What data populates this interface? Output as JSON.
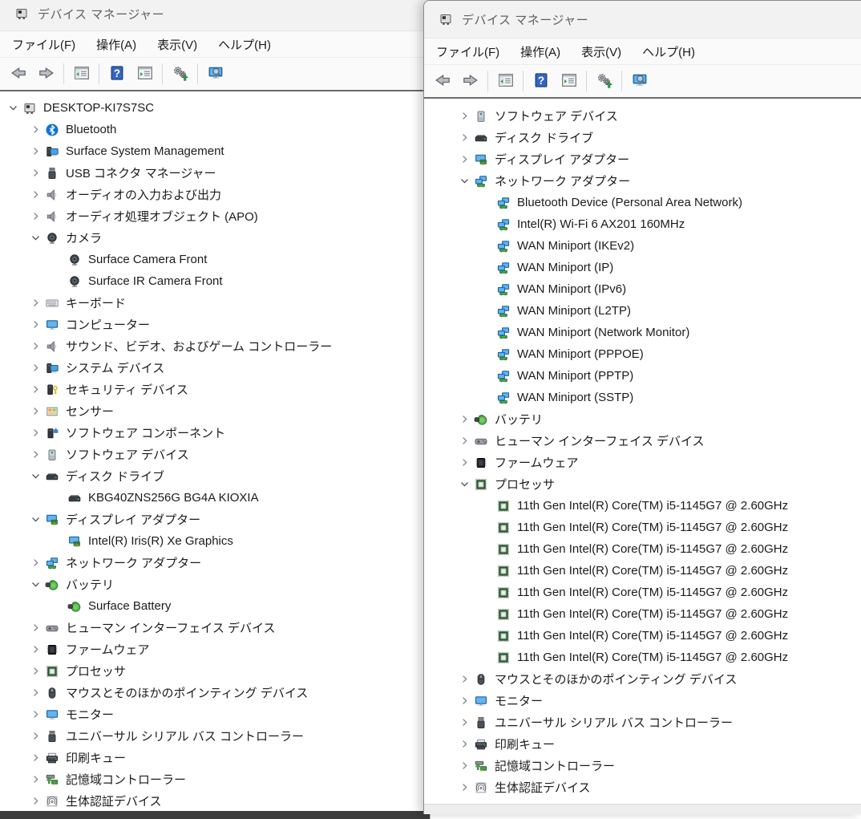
{
  "colors": {
    "accent_blue": "#4aa3e8",
    "status_green": "#46b749",
    "bluetooth_blue": "#1272d6",
    "processor_green": "#2f6136",
    "key_yellow": "#e2b72e",
    "inactive_title_text": "#5f5f5f",
    "tree_text": "#1b1b1b"
  },
  "toolbar_icons": [
    "back",
    "forward",
    "|",
    "show-console-tree",
    "|",
    "help",
    "show-properties",
    "|",
    "scan-hardware",
    "|",
    "search-computer"
  ],
  "windows": {
    "left": {
      "title": "デバイス マネージャー",
      "menu": [
        {
          "name": "file",
          "label": "ファイル(F)"
        },
        {
          "name": "action",
          "label": "操作(A)"
        },
        {
          "name": "view",
          "label": "表示(V)"
        },
        {
          "name": "help",
          "label": "ヘルプ(H)"
        }
      ],
      "tree": [
        {
          "label": "DESKTOP-KI7S7SC",
          "icon": "device-manager",
          "level": 0,
          "expander": "expanded"
        },
        {
          "label": "Bluetooth",
          "icon": "bluetooth",
          "level": 1,
          "expander": "collapsed"
        },
        {
          "label": "Surface System Management",
          "icon": "system",
          "level": 1,
          "expander": "collapsed"
        },
        {
          "label": "USB コネクタ マネージャー",
          "icon": "usb",
          "level": 1,
          "expander": "collapsed"
        },
        {
          "label": "オーディオの入力および出力",
          "icon": "speaker",
          "level": 1,
          "expander": "collapsed"
        },
        {
          "label": "オーディオ処理オブジェクト (APO)",
          "icon": "speaker",
          "level": 1,
          "expander": "collapsed"
        },
        {
          "label": "カメラ",
          "icon": "camera",
          "level": 1,
          "expander": "expanded"
        },
        {
          "label": "Surface Camera Front",
          "icon": "camera",
          "level": 2,
          "expander": "none"
        },
        {
          "label": "Surface IR Camera Front",
          "icon": "camera",
          "level": 2,
          "expander": "none"
        },
        {
          "label": "キーボード",
          "icon": "keyboard",
          "level": 1,
          "expander": "collapsed"
        },
        {
          "label": "コンピューター",
          "icon": "monitor",
          "level": 1,
          "expander": "collapsed"
        },
        {
          "label": "サウンド、ビデオ、およびゲーム コントローラー",
          "icon": "speaker",
          "level": 1,
          "expander": "collapsed"
        },
        {
          "label": "システム デバイス",
          "icon": "system",
          "level": 1,
          "expander": "collapsed"
        },
        {
          "label": "セキュリティ デバイス",
          "icon": "security",
          "level": 1,
          "expander": "collapsed"
        },
        {
          "label": "センサー",
          "icon": "sensor",
          "level": 1,
          "expander": "collapsed"
        },
        {
          "label": "ソフトウェア コンポーネント",
          "icon": "software-component",
          "level": 1,
          "expander": "collapsed"
        },
        {
          "label": "ソフトウェア デバイス",
          "icon": "software-device",
          "level": 1,
          "expander": "collapsed"
        },
        {
          "label": "ディスク ドライブ",
          "icon": "disk",
          "level": 1,
          "expander": "expanded"
        },
        {
          "label": "KBG40ZNS256G BG4A KIOXIA",
          "icon": "disk",
          "level": 2,
          "expander": "none"
        },
        {
          "label": "ディスプレイ アダプター",
          "icon": "display-adapter",
          "level": 1,
          "expander": "expanded"
        },
        {
          "label": "Intel(R) Iris(R) Xe Graphics",
          "icon": "display-adapter",
          "level": 2,
          "expander": "none"
        },
        {
          "label": "ネットワーク アダプター",
          "icon": "network-adapter",
          "level": 1,
          "expander": "collapsed"
        },
        {
          "label": "バッテリ",
          "icon": "battery",
          "level": 1,
          "expander": "expanded"
        },
        {
          "label": "Surface Battery",
          "icon": "battery",
          "level": 2,
          "expander": "none"
        },
        {
          "label": "ヒューマン インターフェイス デバイス",
          "icon": "hid",
          "level": 1,
          "expander": "collapsed"
        },
        {
          "label": "ファームウェア",
          "icon": "firmware",
          "level": 1,
          "expander": "collapsed"
        },
        {
          "label": "プロセッサ",
          "icon": "processor",
          "level": 1,
          "expander": "collapsed"
        },
        {
          "label": "マウスとそのほかのポインティング デバイス",
          "icon": "mouse",
          "level": 1,
          "expander": "collapsed"
        },
        {
          "label": "モニター",
          "icon": "monitor",
          "level": 1,
          "expander": "collapsed"
        },
        {
          "label": "ユニバーサル シリアル バス コントローラー",
          "icon": "usb",
          "level": 1,
          "expander": "collapsed"
        },
        {
          "label": "印刷キュー",
          "icon": "printer",
          "level": 1,
          "expander": "collapsed"
        },
        {
          "label": "記憶域コントローラー",
          "icon": "storage-controller",
          "level": 1,
          "expander": "collapsed"
        },
        {
          "label": "生体認証デバイス",
          "icon": "biometric",
          "level": 1,
          "expander": "collapsed"
        }
      ]
    },
    "right": {
      "title": "デバイス マネージャー",
      "menu": [
        {
          "name": "file",
          "label": "ファイル(F)"
        },
        {
          "name": "action",
          "label": "操作(A)"
        },
        {
          "name": "view",
          "label": "表示(V)"
        },
        {
          "name": "help",
          "label": "ヘルプ(H)"
        }
      ],
      "tree": [
        {
          "label": "ソフトウェア デバイス",
          "icon": "software-device",
          "level": 1,
          "expander": "collapsed"
        },
        {
          "label": "ディスク ドライブ",
          "icon": "disk",
          "level": 1,
          "expander": "collapsed"
        },
        {
          "label": "ディスプレイ アダプター",
          "icon": "display-adapter",
          "level": 1,
          "expander": "collapsed"
        },
        {
          "label": "ネットワーク アダプター",
          "icon": "network-adapter",
          "level": 1,
          "expander": "expanded"
        },
        {
          "label": "Bluetooth Device (Personal Area Network)",
          "icon": "network-adapter",
          "level": 2,
          "expander": "none"
        },
        {
          "label": "Intel(R) Wi-Fi 6 AX201 160MHz",
          "icon": "network-adapter",
          "level": 2,
          "expander": "none"
        },
        {
          "label": "WAN Miniport (IKEv2)",
          "icon": "network-adapter",
          "level": 2,
          "expander": "none"
        },
        {
          "label": "WAN Miniport (IP)",
          "icon": "network-adapter",
          "level": 2,
          "expander": "none"
        },
        {
          "label": "WAN Miniport (IPv6)",
          "icon": "network-adapter",
          "level": 2,
          "expander": "none"
        },
        {
          "label": "WAN Miniport (L2TP)",
          "icon": "network-adapter",
          "level": 2,
          "expander": "none"
        },
        {
          "label": "WAN Miniport (Network Monitor)",
          "icon": "network-adapter",
          "level": 2,
          "expander": "none"
        },
        {
          "label": "WAN Miniport (PPPOE)",
          "icon": "network-adapter",
          "level": 2,
          "expander": "none"
        },
        {
          "label": "WAN Miniport (PPTP)",
          "icon": "network-adapter",
          "level": 2,
          "expander": "none"
        },
        {
          "label": "WAN Miniport (SSTP)",
          "icon": "network-adapter",
          "level": 2,
          "expander": "none"
        },
        {
          "label": "バッテリ",
          "icon": "battery",
          "level": 1,
          "expander": "collapsed"
        },
        {
          "label": "ヒューマン インターフェイス デバイス",
          "icon": "hid",
          "level": 1,
          "expander": "collapsed"
        },
        {
          "label": "ファームウェア",
          "icon": "firmware",
          "level": 1,
          "expander": "collapsed"
        },
        {
          "label": "プロセッサ",
          "icon": "processor",
          "level": 1,
          "expander": "expanded"
        },
        {
          "label": "11th Gen Intel(R) Core(TM) i5-1145G7 @ 2.60GHz",
          "icon": "processor",
          "level": 2,
          "expander": "none"
        },
        {
          "label": "11th Gen Intel(R) Core(TM) i5-1145G7 @ 2.60GHz",
          "icon": "processor",
          "level": 2,
          "expander": "none"
        },
        {
          "label": "11th Gen Intel(R) Core(TM) i5-1145G7 @ 2.60GHz",
          "icon": "processor",
          "level": 2,
          "expander": "none"
        },
        {
          "label": "11th Gen Intel(R) Core(TM) i5-1145G7 @ 2.60GHz",
          "icon": "processor",
          "level": 2,
          "expander": "none"
        },
        {
          "label": "11th Gen Intel(R) Core(TM) i5-1145G7 @ 2.60GHz",
          "icon": "processor",
          "level": 2,
          "expander": "none"
        },
        {
          "label": "11th Gen Intel(R) Core(TM) i5-1145G7 @ 2.60GHz",
          "icon": "processor",
          "level": 2,
          "expander": "none"
        },
        {
          "label": "11th Gen Intel(R) Core(TM) i5-1145G7 @ 2.60GHz",
          "icon": "processor",
          "level": 2,
          "expander": "none"
        },
        {
          "label": "11th Gen Intel(R) Core(TM) i5-1145G7 @ 2.60GHz",
          "icon": "processor",
          "level": 2,
          "expander": "none"
        },
        {
          "label": "マウスとそのほかのポインティング デバイス",
          "icon": "mouse",
          "level": 1,
          "expander": "collapsed"
        },
        {
          "label": "モニター",
          "icon": "monitor",
          "level": 1,
          "expander": "collapsed"
        },
        {
          "label": "ユニバーサル シリアル バス コントローラー",
          "icon": "usb",
          "level": 1,
          "expander": "collapsed"
        },
        {
          "label": "印刷キュー",
          "icon": "printer",
          "level": 1,
          "expander": "collapsed"
        },
        {
          "label": "記憶域コントローラー",
          "icon": "storage-controller",
          "level": 1,
          "expander": "collapsed"
        },
        {
          "label": "生体認証デバイス",
          "icon": "biometric",
          "level": 1,
          "expander": "collapsed"
        }
      ]
    }
  }
}
